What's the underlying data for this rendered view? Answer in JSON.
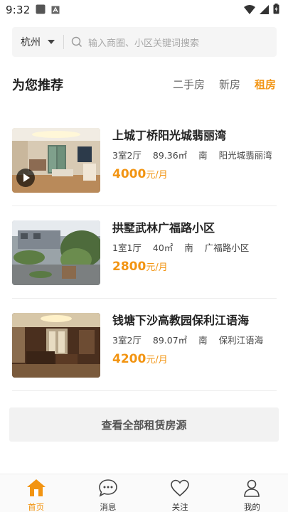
{
  "status_bar": {
    "time": "9:32",
    "icons": [
      "square-notification-icon",
      "a-box-notification-icon",
      "wifi-icon",
      "cellular-signal-icon",
      "battery-icon"
    ]
  },
  "search": {
    "city": "杭州",
    "placeholder": "输入商圈、小区关键词搜索"
  },
  "section": {
    "title": "为您推荐",
    "tabs": [
      {
        "label": "二手房",
        "active": false
      },
      {
        "label": "新房",
        "active": false
      },
      {
        "label": "租房",
        "active": true
      }
    ]
  },
  "listings": [
    {
      "title": "上城丁桥阳光城翡丽湾",
      "layout": "3室2厅",
      "area": "89.36㎡",
      "orientation": "南",
      "community": "阳光城翡丽湾",
      "price": "4000",
      "unit": "元/月",
      "has_video": true
    },
    {
      "title": "拱墅武林广福路小区",
      "layout": "1室1厅",
      "area": "40㎡",
      "orientation": "南",
      "community": "广福路小区",
      "price": "2800",
      "unit": "元/月",
      "has_video": false
    },
    {
      "title": "钱塘下沙高教园保利江语海",
      "layout": "3室2厅",
      "area": "89.07㎡",
      "orientation": "南",
      "community": "保利江语海",
      "price": "4200",
      "unit": "元/月",
      "has_video": false
    }
  ],
  "view_all_label": "查看全部租赁房源",
  "tabbar": {
    "items": [
      {
        "label": "首页",
        "icon": "home-icon",
        "active": true
      },
      {
        "label": "消息",
        "icon": "message-bubble-icon",
        "active": false
      },
      {
        "label": "关注",
        "icon": "heart-icon",
        "active": false
      },
      {
        "label": "我的",
        "icon": "person-icon",
        "active": false
      }
    ]
  },
  "colors": {
    "accent": "#f29412",
    "search_bg": "#f5f5f5",
    "button_bg": "#f2f2f2"
  }
}
